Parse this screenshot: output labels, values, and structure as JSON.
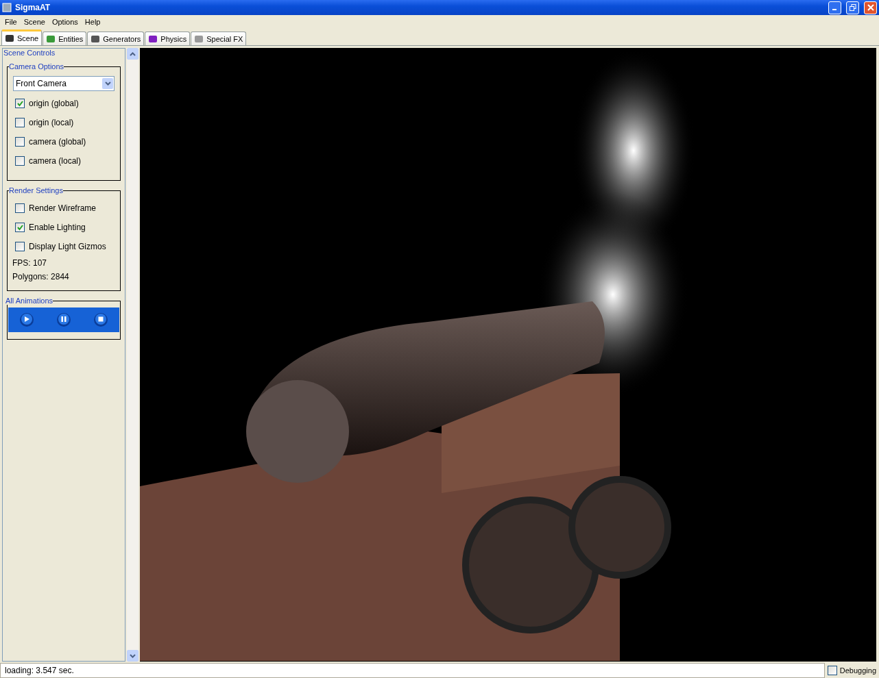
{
  "window": {
    "title": "SigmaAT"
  },
  "menu": [
    "File",
    "Scene",
    "Options",
    "Help"
  ],
  "tabs": [
    {
      "label": "Scene",
      "selected": true
    },
    {
      "label": "Entities",
      "selected": false
    },
    {
      "label": "Generators",
      "selected": false
    },
    {
      "label": "Physics",
      "selected": false
    },
    {
      "label": "Special FX",
      "selected": false
    }
  ],
  "scene_controls": {
    "title": "Scene Controls",
    "camera_options": {
      "title": "Camera Options",
      "dropdown": {
        "value": "Front Camera"
      },
      "checkboxes": [
        {
          "label": "origin (global)",
          "checked": true
        },
        {
          "label": "origin (local)",
          "checked": false
        },
        {
          "label": "camera (global)",
          "checked": false
        },
        {
          "label": "camera (local)",
          "checked": false
        }
      ]
    },
    "render_settings": {
      "title": "Render Settings",
      "checkboxes": [
        {
          "label": "Render Wireframe",
          "checked": false
        },
        {
          "label": "Enable Lighting",
          "checked": true
        },
        {
          "label": "Display Light Gizmos",
          "checked": false
        }
      ],
      "stats": [
        "FPS: 107",
        "Polygons: 2844"
      ]
    },
    "all_animations": {
      "title": "All Animations"
    }
  },
  "status_bar": {
    "text": "loading: 3.547 sec.",
    "debugging": {
      "label": "Debugging",
      "checked": false
    }
  }
}
